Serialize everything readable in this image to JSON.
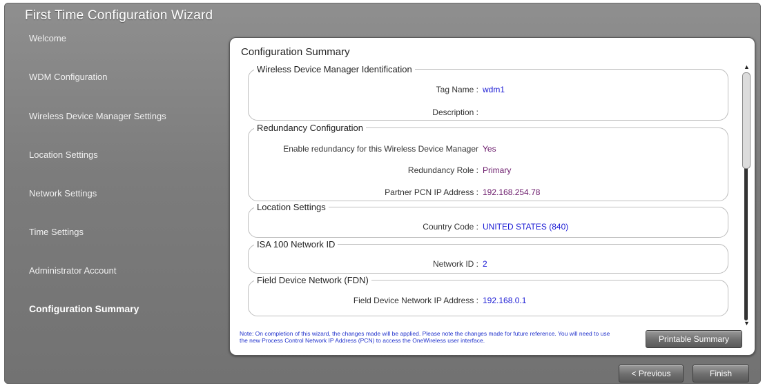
{
  "wizard_title": "First Time Configuration Wizard",
  "steps": [
    {
      "label": "Welcome"
    },
    {
      "label": "WDM Configuration"
    },
    {
      "label": "Wireless Device Manager Settings"
    },
    {
      "label": "Location Settings"
    },
    {
      "label": "Network Settings"
    },
    {
      "label": "Time Settings"
    },
    {
      "label": "Administrator Account"
    },
    {
      "label": "Configuration Summary",
      "active": true
    }
  ],
  "summary": {
    "title": "Configuration Summary",
    "identification": {
      "legend": "Wireless Device Manager Identification",
      "tag_name_label": "Tag Name :",
      "tag_name_value": "wdm1",
      "description_label": "Description :",
      "description_value": ""
    },
    "redundancy": {
      "legend": "Redundancy Configuration",
      "enable_label": "Enable redundancy for this Wireless Device Manager",
      "enable_value": "Yes",
      "role_label": "Redundancy Role :",
      "role_value": "Primary",
      "partner_label": "Partner PCN IP Address :",
      "partner_value": "192.168.254.78"
    },
    "location": {
      "legend": "Location Settings",
      "country_label": "Country Code :",
      "country_value": "UNITED STATES (840)"
    },
    "isa": {
      "legend": "ISA 100 Network ID",
      "network_id_label": "Network ID :",
      "network_id_value": "2"
    },
    "fdn": {
      "legend": "Field Device Network (FDN)",
      "ip_label": "Field Device Network IP Address :",
      "ip_value": "192.168.0.1"
    },
    "note": "Note: On completion of this wizard, the changes made will be applied. Please note the changes made for future reference. You will need to use the new Process Control Network IP Address (PCN) to access the OneWireless user interface.",
    "printable_button": "Printable Summary"
  },
  "nav": {
    "previous": "< Previous",
    "finish": "Finish"
  },
  "colors": {
    "value_blue": "#1a1ad4",
    "value_purple": "#6b1a6b"
  }
}
